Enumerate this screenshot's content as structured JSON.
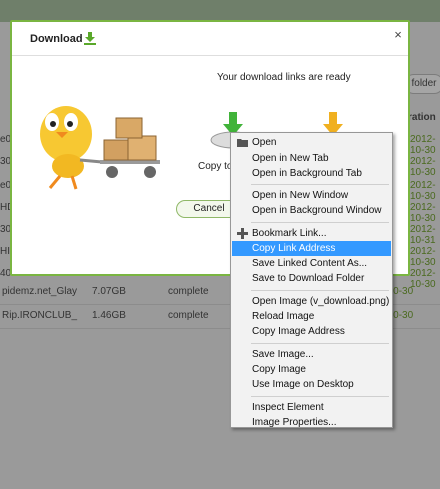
{
  "background": {
    "folder_button": "folder",
    "column_header": "ration",
    "rows": [
      {
        "name": "pidemz.net_Glay",
        "size": "7.07GB",
        "status": "complete",
        "date": "2012-10-30"
      },
      {
        "name": "Rip.IRONCLUB_",
        "size": "1.46GB",
        "status": "complete",
        "date": "2012-10-30"
      }
    ],
    "left_fragments": [
      "e0",
      "30",
      "e0",
      "HD",
      "30",
      "HI",
      "40"
    ],
    "right_dates": [
      "2012-10-30",
      "2012-10-30",
      "2012-10-30",
      "2012-10-30",
      "2012-10-31",
      "2012-10-30",
      "2012-10-30",
      "2012-10-30"
    ]
  },
  "modal": {
    "title": "Download",
    "ready_text": "Your download links are ready",
    "copy_caption": "Copy to C",
    "cancel_label": "Cancel"
  },
  "context_menu": {
    "highlight_color": "#3399ff",
    "items": [
      {
        "label": "Open",
        "icon": "folder-icon"
      },
      {
        "label": "Open in New Tab"
      },
      {
        "label": "Open in Background Tab"
      },
      {
        "label": "Open in New Window"
      },
      {
        "label": "Open in Background Window"
      },
      {
        "label": "Bookmark Link...",
        "icon": "plus-icon"
      },
      {
        "label": "Copy Link Address",
        "highlighted": true
      },
      {
        "label": "Save Linked Content As..."
      },
      {
        "label": "Save to Download Folder"
      },
      {
        "label": "Open Image (v_download.png)"
      },
      {
        "label": "Reload Image"
      },
      {
        "label": "Copy Image Address"
      },
      {
        "label": "Save Image..."
      },
      {
        "label": "Copy Image"
      },
      {
        "label": "Use Image on Desktop"
      },
      {
        "label": "Inspect Element"
      },
      {
        "label": "Image Properties..."
      }
    ]
  }
}
